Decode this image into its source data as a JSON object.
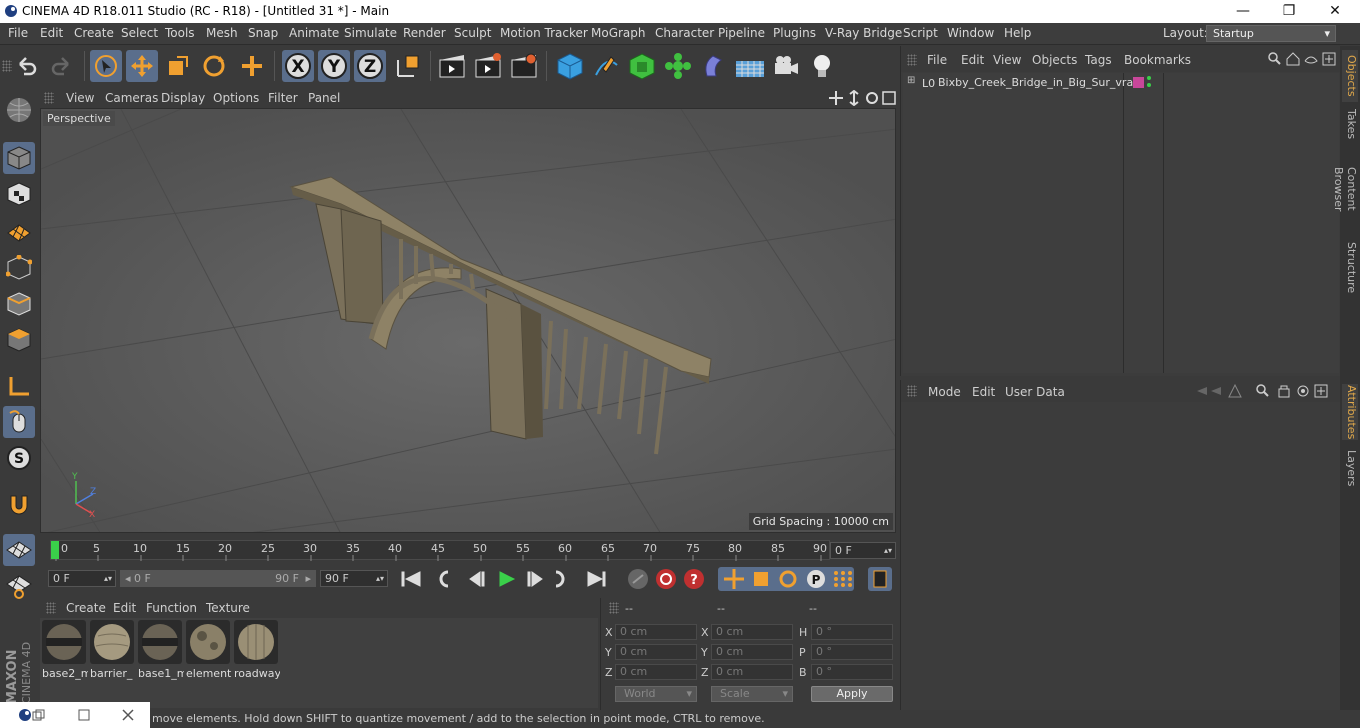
{
  "window": {
    "title": "CINEMA 4D R18.011 Studio (RC - R18) - [Untitled 31 *] - Main",
    "min": "—",
    "max": "❐",
    "close": "✕"
  },
  "menu": [
    "File",
    "Edit",
    "Create",
    "Select",
    "Tools",
    "Mesh",
    "Snap",
    "Animate",
    "Simulate",
    "Render",
    "Sculpt",
    "Motion Tracker",
    "MoGraph",
    "Character",
    "Pipeline",
    "Plugins",
    "V-Ray Bridge",
    "Script",
    "Window",
    "Help"
  ],
  "layout": {
    "label": "Layout:",
    "value": "Startup"
  },
  "viewport": {
    "menu": [
      "View",
      "Cameras",
      "Display",
      "Options",
      "Filter",
      "Panel"
    ],
    "label": "Perspective",
    "grid_spacing": "Grid Spacing : 10000 cm",
    "axis": {
      "x": "X",
      "y": "Y",
      "z": "Z"
    }
  },
  "timeline": {
    "ticks": [
      "0",
      "5",
      "10",
      "15",
      "20",
      "25",
      "30",
      "35",
      "40",
      "45",
      "50",
      "55",
      "60",
      "65",
      "70",
      "75",
      "80",
      "85",
      "90"
    ],
    "current": "0 F"
  },
  "transport": {
    "start": "0 F",
    "range_start": "0 F",
    "range_end": "90 F",
    "end": "90 F"
  },
  "material_menu": [
    "Create",
    "Edit",
    "Function",
    "Texture"
  ],
  "materials": [
    "base2_m",
    "barrier_",
    "base1_m",
    "element",
    "roadway"
  ],
  "coords": {
    "headers": [
      "--",
      "--",
      "--"
    ],
    "rows": [
      {
        "a": "X",
        "av": "0 cm",
        "b": "X",
        "bv": "0 cm",
        "c": "H",
        "cv": "0 °"
      },
      {
        "a": "Y",
        "av": "0 cm",
        "b": "Y",
        "bv": "0 cm",
        "c": "P",
        "cv": "0 °"
      },
      {
        "a": "Z",
        "av": "0 cm",
        "b": "Z",
        "bv": "0 cm",
        "c": "B",
        "cv": "0 °"
      }
    ],
    "world": "World",
    "scale": "Scale",
    "apply": "Apply"
  },
  "status": "move elements. Hold down SHIFT to quantize movement / add to the selection in point mode, CTRL to remove.",
  "objects_menu": [
    "File",
    "Edit",
    "View",
    "Objects",
    "Tags",
    "Bookmarks"
  ],
  "objects": [
    {
      "name": "Bixby_Creek_Bridge_in_Big_Sur_vray",
      "tag_color": "#c8479a"
    }
  ],
  "attributes_menu": [
    "Mode",
    "Edit",
    "User Data"
  ],
  "side_tabs": [
    "Objects",
    "Takes",
    "Content Browser",
    "Structure",
    "Attributes",
    "Layers"
  ],
  "brand": {
    "maxon": "MAXON",
    "c4d": "CINEMA 4D"
  },
  "colors": {
    "accent": "#5a6e8c",
    "bg": "#3a3a3a",
    "viewport": "#5e5e5e",
    "tab_active": "#e0a84a"
  }
}
